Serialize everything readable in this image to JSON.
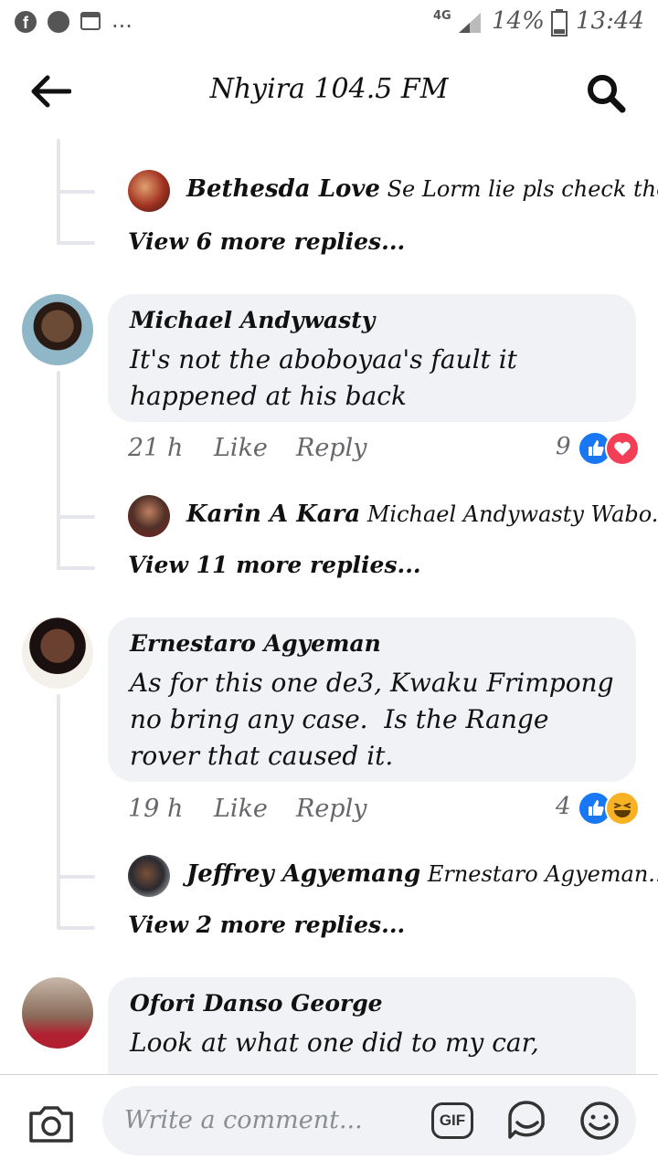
{
  "status_bar": {
    "network": "4G",
    "battery": "14%",
    "time": "13:44",
    "more": "..."
  },
  "header": {
    "title": "Nhyira 104.5 FM"
  },
  "top_thread": {
    "reply_preview_name": "Bethesda Love",
    "reply_preview_text": "Se Lorm lie pls check the...",
    "view_more": "View 6 more replies..."
  },
  "comments": [
    {
      "name": "Michael Andywasty",
      "text_lines": [
        "It's not the aboboyaa's fault it",
        "happened at his back"
      ],
      "time": "21 h",
      "like": "Like",
      "reply": "Reply",
      "reaction_count": "9",
      "reactions": [
        "like-icon",
        "love-icon"
      ],
      "reply_preview_name": "Karin A Kara",
      "reply_preview_text": "Michael Andywasty Wabo...",
      "view_more": "View 11 more replies..."
    },
    {
      "name": "Ernestaro Agyeman",
      "text_lines": [
        "As for this one de3, Kwaku Frimpong",
        "no bring any case.  Is the Range",
        "rover that caused it."
      ],
      "time": "19 h",
      "like": "Like",
      "reply": "Reply",
      "reaction_count": "4",
      "reactions": [
        "like-icon",
        "haha-icon"
      ],
      "reply_preview_name": "Jeffrey Agyemang",
      "reply_preview_text": "Ernestaro Agyeman...",
      "view_more": "View 2 more replies..."
    },
    {
      "name": "Ofori Danso George",
      "text_lines": [
        "Look at what one did to my car,"
      ]
    }
  ],
  "composer": {
    "placeholder": "Write a comment...",
    "gif_label": "GIF"
  },
  "colors": {
    "bubble": "#f0f2f5",
    "like_blue": "#1877f2",
    "love_red": "#f33e58",
    "haha_yellow": "#f7b125"
  }
}
